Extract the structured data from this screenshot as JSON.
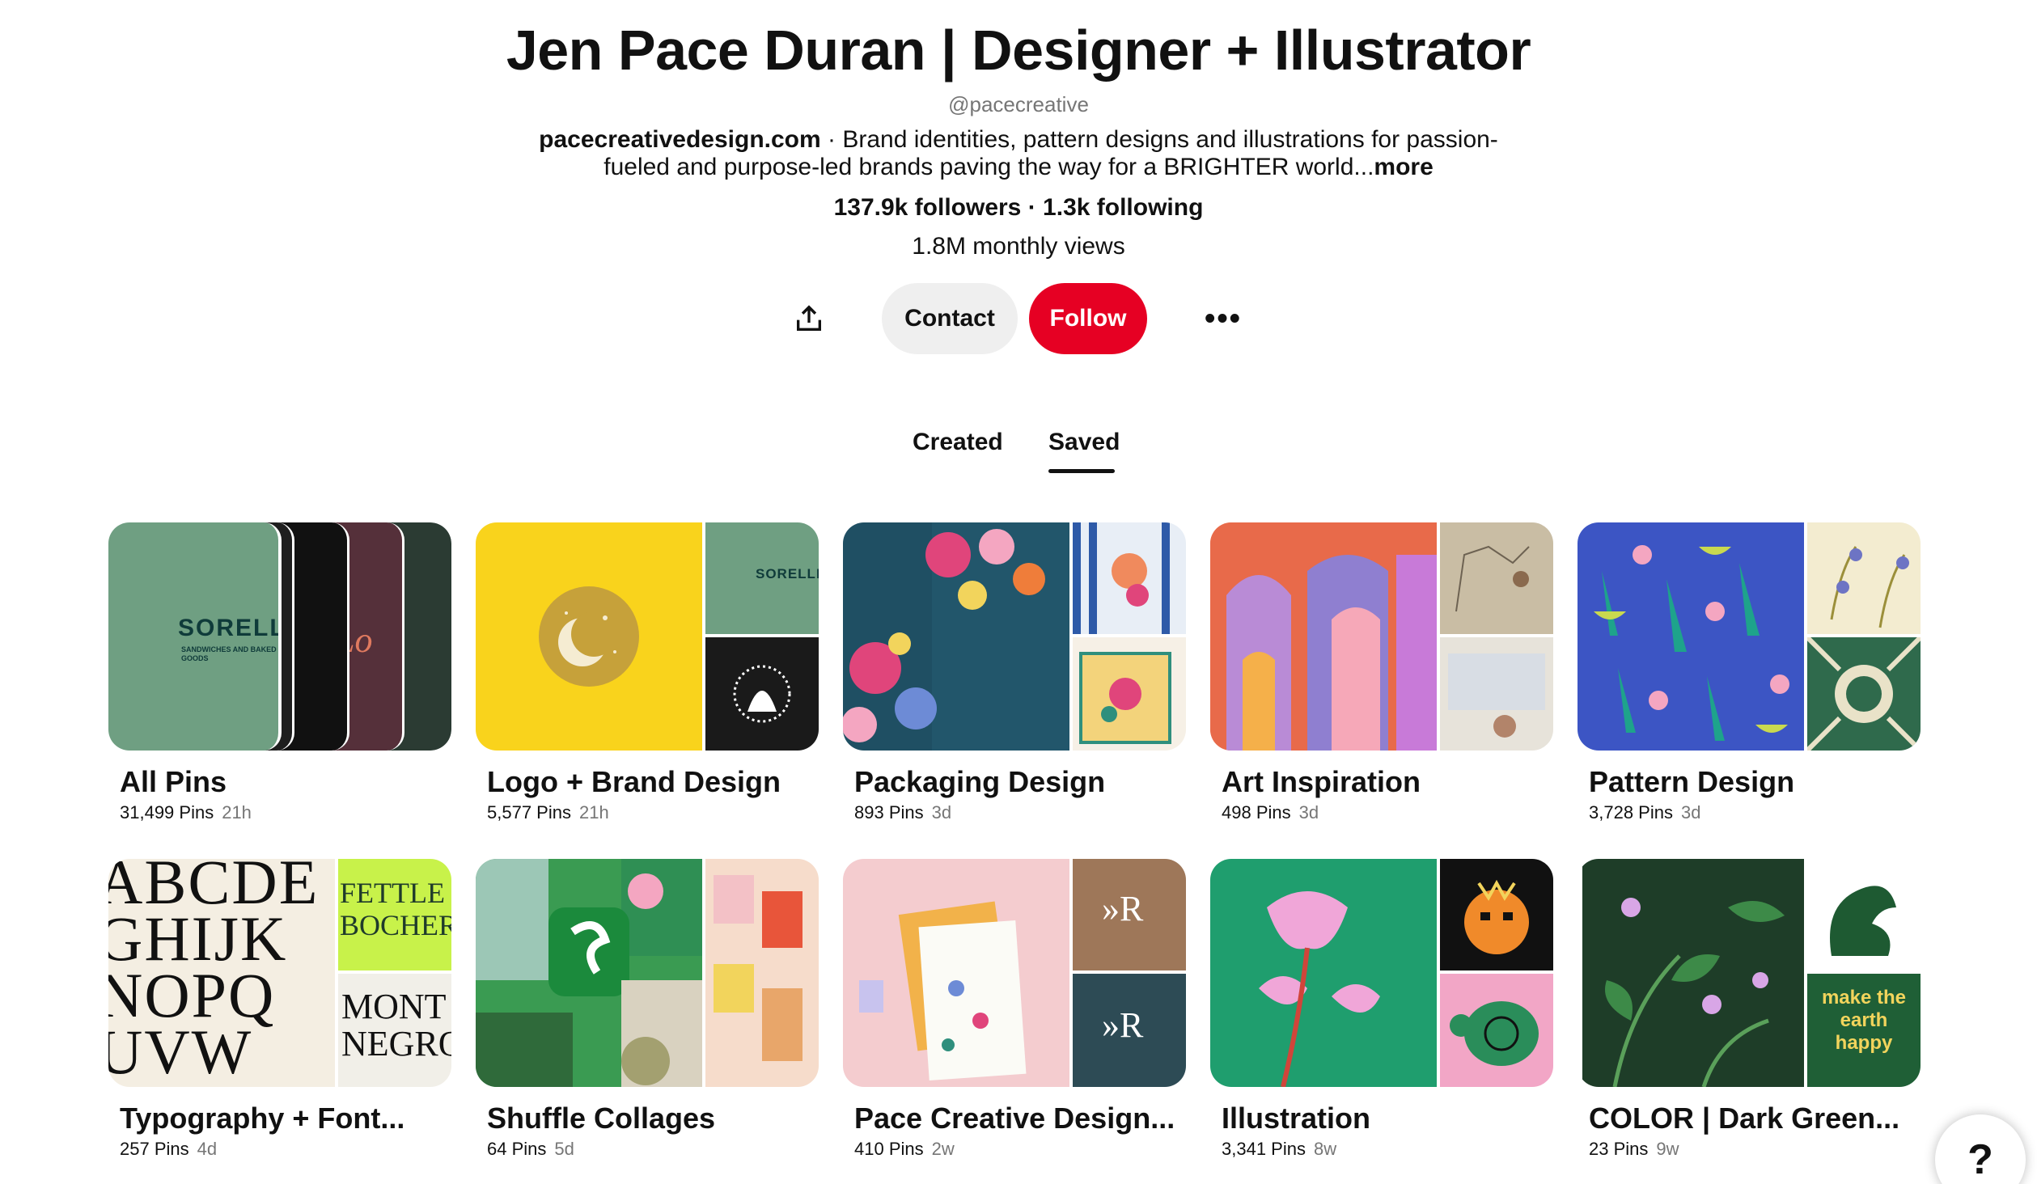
{
  "profile": {
    "name": "Jen Pace Duran | Designer + Illustrator",
    "handle": "@pacecreative",
    "website": "pacecreativedesign.com",
    "bio_line1": " · Brand identities, pattern designs and illustrations for passion-",
    "bio_line2": "fueled and purpose-led brands paving the way for a BRIGHTER world...",
    "bio_more": "more",
    "followers": "137.9k followers",
    "separator": " · ",
    "following": "1.3k following",
    "monthly_views": "1.8M monthly views"
  },
  "actions": {
    "share_icon": "share-icon",
    "contact_label": "Contact",
    "follow_label": "Follow",
    "more_icon": "more-options-icon",
    "more_glyph": "•••"
  },
  "tabs": {
    "created": "Created",
    "saved": "Saved",
    "active": "Saved"
  },
  "boards": [
    {
      "title": "All Pins",
      "pins": "31,499 Pins",
      "age": "21h"
    },
    {
      "title": "Logo + Brand Design",
      "pins": "5,577 Pins",
      "age": "21h"
    },
    {
      "title": "Packaging Design",
      "pins": "893 Pins",
      "age": "3d"
    },
    {
      "title": "Art Inspiration",
      "pins": "498 Pins",
      "age": "3d"
    },
    {
      "title": "Pattern Design",
      "pins": "3,728 Pins",
      "age": "3d"
    },
    {
      "title": "Typography + Font...",
      "pins": "257 Pins",
      "age": "4d"
    },
    {
      "title": "Shuffle Collages",
      "pins": "64 Pins",
      "age": "5d"
    },
    {
      "title": "Pace Creative Design...",
      "pins": "410 Pins",
      "age": "2w"
    },
    {
      "title": "Illustration",
      "pins": "3,341 Pins",
      "age": "8w"
    },
    {
      "title": "COLOR | Dark Green...",
      "pins": "23 Pins",
      "age": "9w"
    }
  ],
  "cover_text": {
    "sorelle": "SORELLE",
    "sorelle_sub": "SANDWICHES AND BAKED GOODS",
    "r_mark": "»R",
    "alphabet_1": "ABCDE",
    "alphabet_2": "GHIJK",
    "alphabet_3": "NOPQ",
    "alphabet_4": "UVW",
    "font_a": "FETTLE",
    "font_b": "BOCHER",
    "font_c": "MONT",
    "font_d": "NEGRO",
    "make_earth": "make the earth happy"
  },
  "help": {
    "glyph": "?"
  },
  "colors": {
    "follow_red": "#e60023",
    "contact_gray": "#efefef",
    "meta_gray": "#767676"
  }
}
